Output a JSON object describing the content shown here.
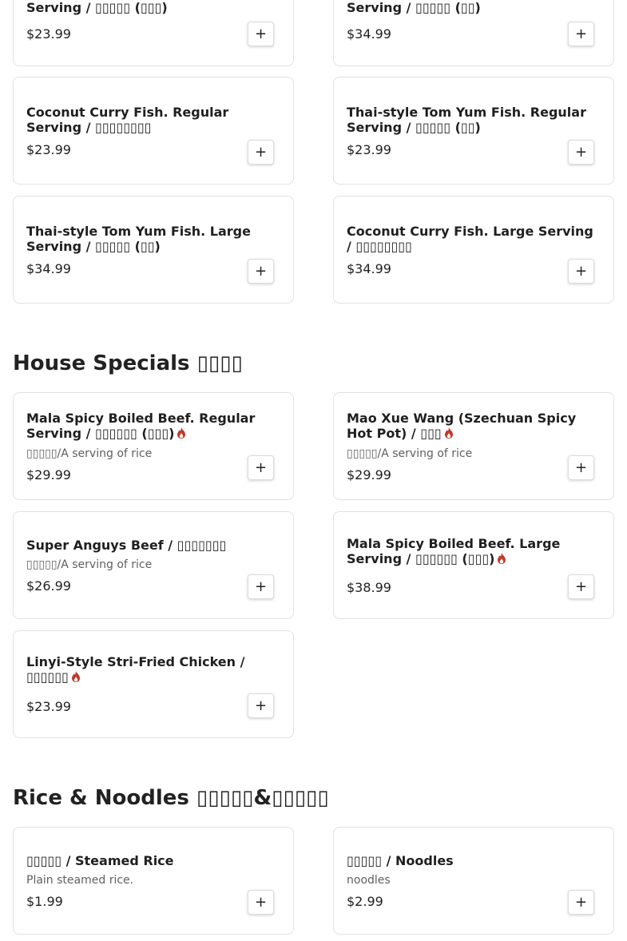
{
  "colors": {
    "spicy": "#c0392b",
    "border": "#e2e2e2"
  },
  "top_items": [
    {
      "name": "Serving / ▯▯▯▯▯ (▯▯▯)",
      "price": "$23.99"
    },
    {
      "name": "Serving / ▯▯▯▯▯ (▯▯)",
      "price": "$34.99"
    },
    {
      "name": "Coconut Curry Fish. Regular Serving / ▯▯▯▯▯▯▯▯",
      "price": "$23.99"
    },
    {
      "name": "Thai-style Tom Yum Fish. Regular Serving / ▯▯▯▯▯ (▯▯)",
      "price": "$23.99"
    },
    {
      "name": "Thai-style Tom Yum Fish. Large Serving / ▯▯▯▯▯ (▯▯)",
      "price": "$34.99"
    },
    {
      "name": "Coconut Curry Fish. Large Serving / ▯▯▯▯▯▯▯▯",
      "price": "$34.99"
    }
  ],
  "house_specials": {
    "title": "House Specials ▯▯▯▯",
    "items": [
      {
        "name": "Mala Spicy Boiled Beef. Regular Serving / ▯▯▯▯▯▯ (▯▯▯)",
        "desc": "▯▯▯▯▯/A serving of rice",
        "price": "$29.99",
        "spicy": true
      },
      {
        "name": "Mao Xue Wang (Szechuan Spicy Hot Pot) / ▯▯▯",
        "desc": "▯▯▯▯▯/A serving of rice",
        "price": "$29.99",
        "spicy": true
      },
      {
        "name": "Super Anguys Beef / ▯▯▯▯▯▯▯",
        "desc": "▯▯▯▯▯/A serving of rice",
        "price": "$26.99",
        "spicy": false
      },
      {
        "name": "Mala Spicy Boiled Beef. Large Serving / ▯▯▯▯▯▯ (▯▯▯)",
        "desc": "",
        "price": "$38.99",
        "spicy": true
      },
      {
        "name": "Linyi-Style Stri-Fried Chicken / ▯▯▯▯▯▯",
        "desc": "",
        "price": "$23.99",
        "spicy": true
      }
    ]
  },
  "rice_noodles": {
    "title": "Rice & Noodles ▯▯▯▯▯&▯▯▯▯▯",
    "items": [
      {
        "name": "▯▯▯▯▯ / Steamed Rice",
        "desc": "Plain steamed rice.",
        "price": "$1.99"
      },
      {
        "name": "▯▯▯▯▯ / Noodles",
        "desc": "noodles",
        "price": "$2.99"
      }
    ]
  },
  "add_button": {
    "label": "+"
  }
}
